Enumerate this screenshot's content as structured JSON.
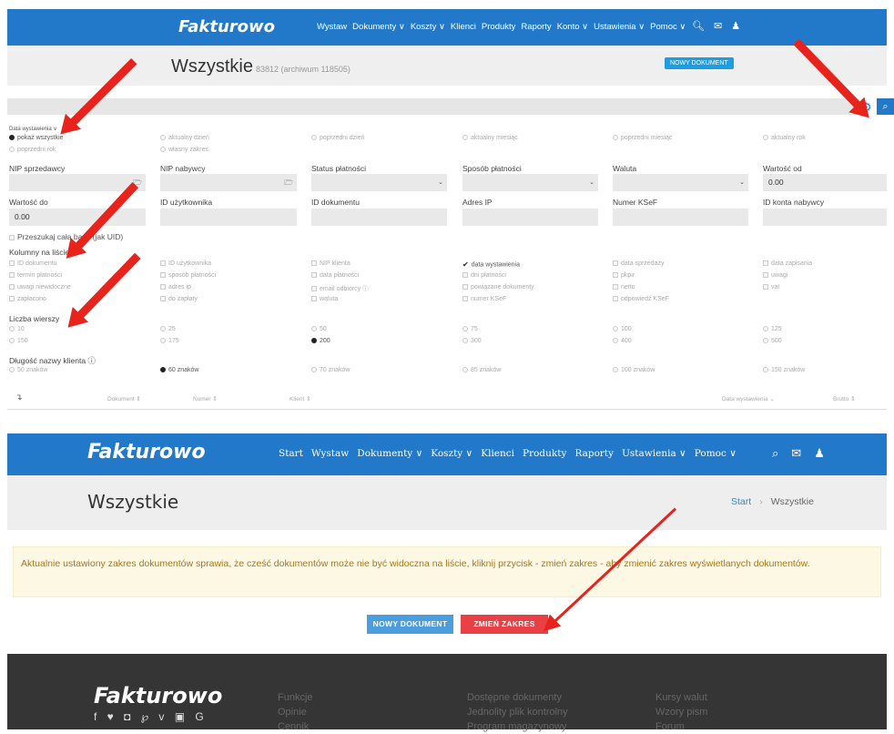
{
  "top": {
    "logo": "Fakturowo",
    "menu": [
      "Wystaw",
      "Dokumenty ∨",
      "Koszty ∨",
      "Klienci",
      "Produkty",
      "Raporty",
      "Konto ∨",
      "Ustawienia ∨",
      "Pomoc ∨"
    ],
    "title": "Wszystkie",
    "count": "83812 (archiwum 118505)",
    "new_doc": "NOWY DOKUMENT",
    "date_label": "Data wystawienia ∨",
    "date_options": [
      "pokaż wszystkie",
      "aktualny dzień",
      "poprzedni dzień",
      "aktualny miesiąc",
      "poprzedni miesiąc",
      "aktualny rok",
      "poprzedni rok",
      "własny zakres"
    ],
    "filters": {
      "nip_seller": "NIP sprzedawcy",
      "nip_buyer": "NIP nabywcy",
      "payment_status": "Status płatności",
      "payment_method": "Sposób płatności",
      "currency": "Waluta",
      "value_from": "Wartość od",
      "value_from_val": "0.00",
      "value_to": "Wartość do",
      "value_to_val": "0.00",
      "user_id": "ID użytkownika",
      "doc_id": "ID dokumentu",
      "ip": "Adres IP",
      "ksef": "Numer KSeF",
      "buyer_acc": "ID konta nabywcy"
    },
    "search_all": "Przeszukaj całą bazę (jak UID)",
    "columns_label": "Kolumny na liście",
    "columns": [
      [
        "ID dokumentu",
        "termin płatności",
        "uwagi niewidoczne",
        "zapłacono"
      ],
      [
        "ID użytkownika",
        "sposób płatności",
        "adres ip",
        "do zapłaty"
      ],
      [
        "NIP klienta",
        "data płatności",
        "email odbiorcy ⓘ",
        "waluta"
      ],
      [
        "data wystawienia",
        "dni płatności",
        "powiązane dokumenty",
        "numer KSeF"
      ],
      [
        "data sprzedaży",
        "pkpir",
        "netto",
        "odpowiedź KSeF"
      ],
      [
        "data zapisania",
        "uwagi",
        "vat"
      ]
    ],
    "rows_label": "Liczba wierszy",
    "rows": [
      [
        "10",
        "150"
      ],
      [
        "25",
        "175"
      ],
      [
        "50",
        "200"
      ],
      [
        "75",
        "300"
      ],
      [
        "100",
        "400"
      ],
      [
        "125",
        "500"
      ]
    ],
    "name_len_label": "Długość nazwy klienta ⓘ",
    "name_len": [
      "50 znaków",
      "60 znaków",
      "70 znaków",
      "85 znaków",
      "100 znaków",
      "150 znaków"
    ],
    "table_headers": [
      "Dokument ⇕",
      "Numer ⇕",
      "Klient ⇕",
      "Data wystawienia ⌄",
      "Brutto ⇕"
    ]
  },
  "bottom": {
    "logo": "Fakturowo",
    "menu": [
      "Start",
      "Wystaw",
      "Dokumenty ∨",
      "Koszty ∨",
      "Klienci",
      "Produkty",
      "Raporty",
      "Ustawienia ∨",
      "Pomoc ∨"
    ],
    "title": "Wszystkie",
    "crumb_home": "Start",
    "crumb_sep": "›",
    "crumb_current": "Wszystkie",
    "alert": "Aktualnie ustawiony zakres dokumentów sprawia, że cześć dokumentów może nie być widoczna na liście, kliknij przycisk - zmień zakres - aby zmienić zakres wyświetlanych dokumentów.",
    "btn_new": "NOWY DOKUMENT",
    "btn_range": "ZMIEŃ ZAKRES",
    "footer_logo": "Fakturowo",
    "footer_social": "f ♥ ◘ ℘ v ▣ G",
    "footer_col1": [
      "Funkcje",
      "Opinie",
      "Cennik"
    ],
    "footer_col2": [
      "Dostępne dokumenty",
      "Jednolity plik kontrolny",
      "Program magazynowy"
    ],
    "footer_col3": [
      "Kursy walut",
      "Wzory pism",
      "Forum"
    ]
  },
  "colors": {
    "brand": "#2379c9",
    "arrow": "#e8231c",
    "danger": "#e84045"
  }
}
